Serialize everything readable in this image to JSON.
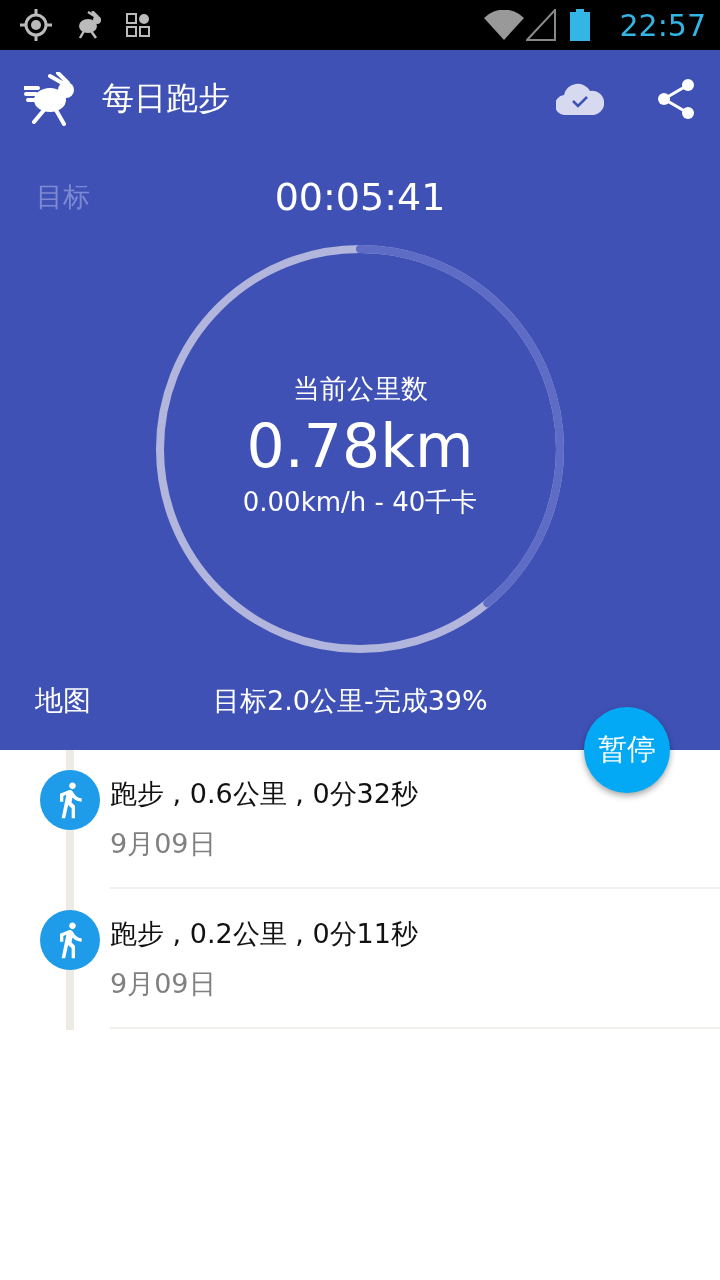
{
  "status_bar": {
    "time": "22:57"
  },
  "app_bar": {
    "title": "每日跑步"
  },
  "tracker": {
    "goal_label": {
      "text": "目标",
      "disabled": true
    },
    "timer": "00:05:41",
    "ring": {
      "level": 0.39
    },
    "caption": "当前公里数",
    "distance": "0.78km",
    "stats": "0.00km/h - 40千卡",
    "map_link": "地图",
    "summary": "目标2.0公里-完成39%"
  },
  "pause_button": {
    "label": "暂停"
  },
  "records": [
    {
      "title": "跑步 , 0.6公里 , 0分32秒",
      "date": "9月09日"
    },
    {
      "title": "跑步 , 0.2公里 , 0分11秒",
      "date": "9月09日"
    }
  ]
}
